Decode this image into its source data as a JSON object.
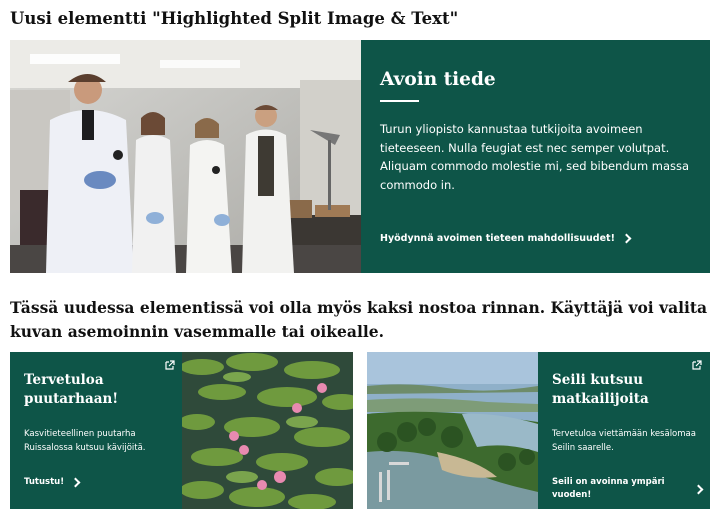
{
  "heading1": "Uusi elementti \"Highlighted Split Image & Text\"",
  "split": {
    "title": "Avoin tiede",
    "body": "Turun yliopisto kannustaa tutkijoita avoimeen tieteeseen. Nulla feugiat est nec semper volutpat. Aliquam commodo molestie mi, sed bibendum massa commodo in.",
    "link": "Hyödynnä avoimen tieteen mahdollisuudet!",
    "image_icon": "lab-researchers-photo",
    "accent": "#0e5548"
  },
  "heading2": "Tässä uudessa elementissä voi olla myös kaksi nostoa rinnan. Käyttäjä voi valita kuvan asemoinnin vasemmalle tai oikealle.",
  "cards": [
    {
      "title": "Tervetuloa puutarhaan!",
      "body": "Kasvitieteellinen puutarha Ruissalossa kutsuu kävijöitä.",
      "link": "Tutustu!",
      "image_icon": "water-lilies-photo"
    },
    {
      "title": "Seili kutsuu matkailijoita",
      "body": "Tervetuloa viettämään kesälomaa Seilin saarelle.",
      "link": "Seili on avoinna ympäri vuoden!",
      "image_icon": "archipelago-aerial-photo"
    }
  ]
}
